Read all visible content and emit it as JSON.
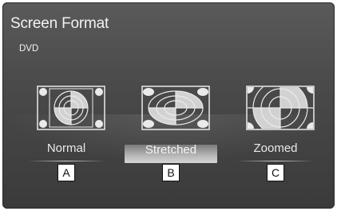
{
  "header": {
    "title": "Screen Format",
    "source": "DVD"
  },
  "options": [
    {
      "label": "Normal",
      "callout": "A",
      "selected": false
    },
    {
      "label": "Stretched",
      "callout": "B",
      "selected": true
    },
    {
      "label": "Zoomed",
      "callout": "C",
      "selected": false
    }
  ],
  "colors": {
    "background": "#4a4a4a",
    "text": "#f2f2f2",
    "selected_bar": "#c8c8c8"
  }
}
